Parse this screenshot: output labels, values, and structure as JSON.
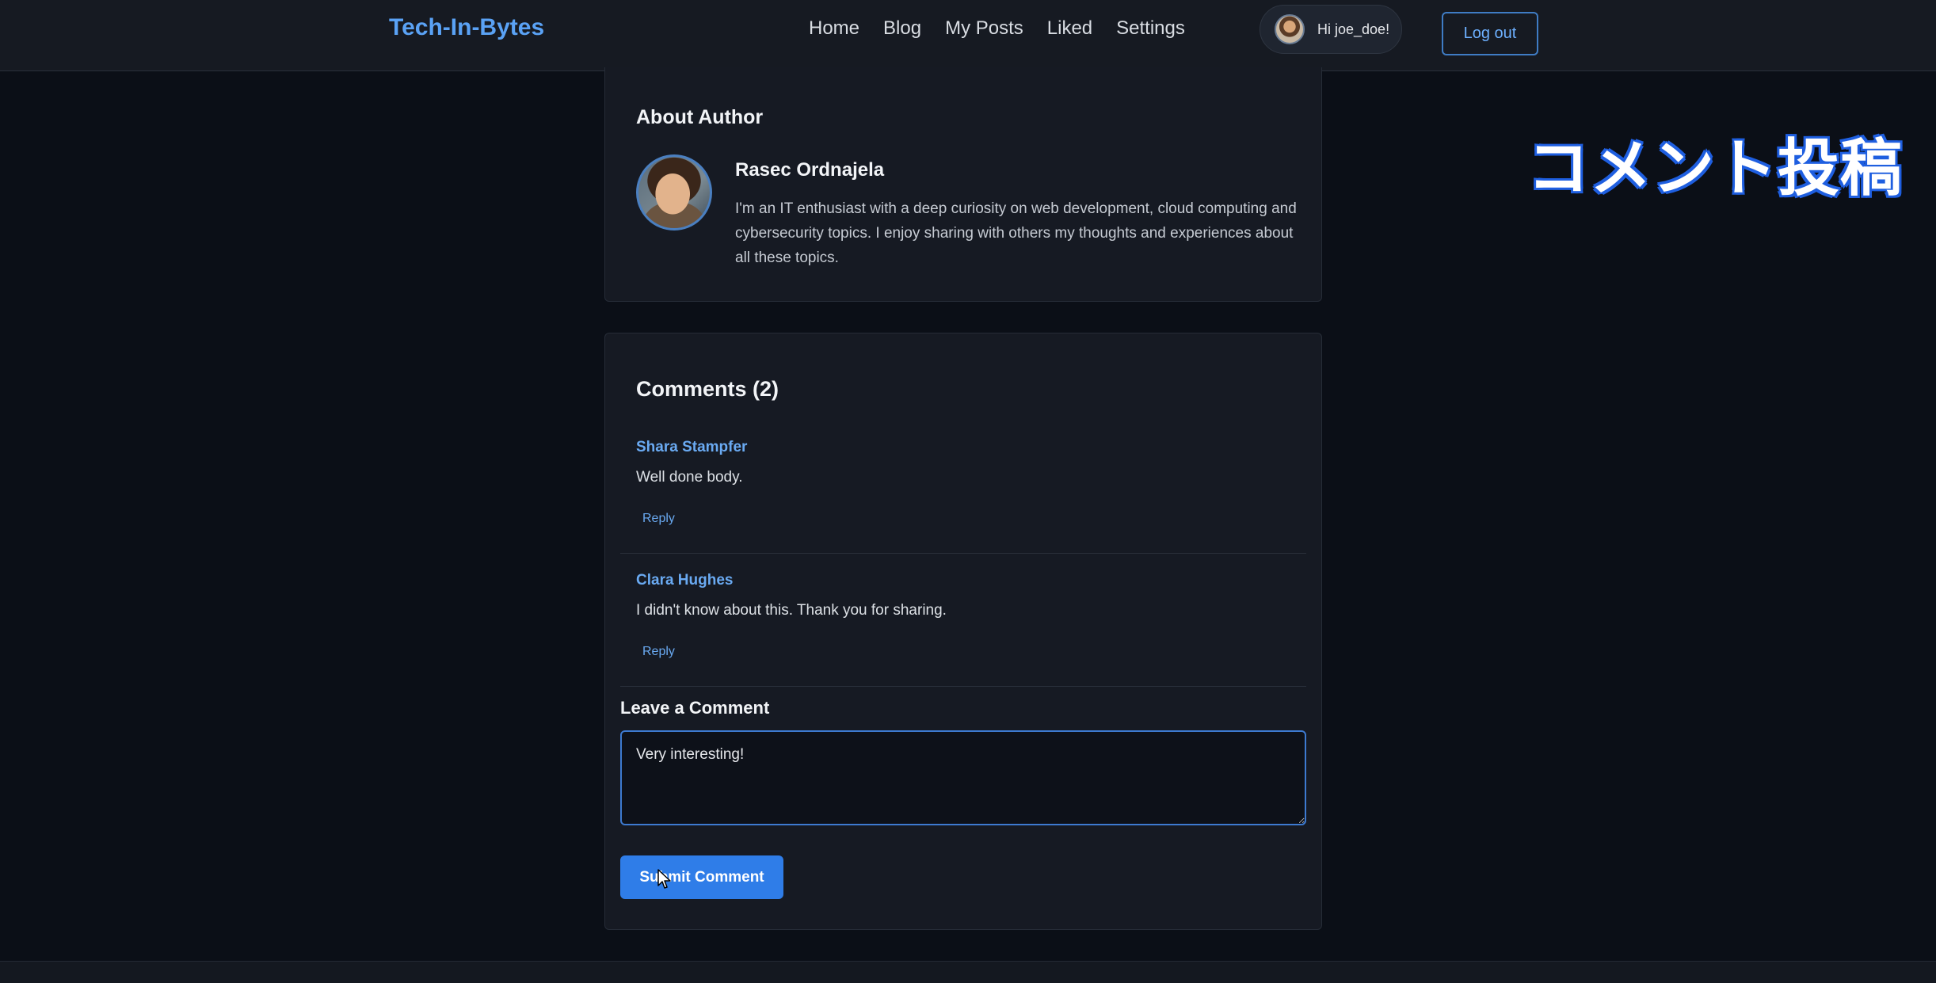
{
  "nav": {
    "brand": "Tech-In-Bytes",
    "links": [
      "Home",
      "Blog",
      "My Posts",
      "Liked",
      "Settings"
    ],
    "user_greeting": "Hi joe_doe!",
    "logout_label": "Log out"
  },
  "overlay": {
    "caption": "コメント投稿"
  },
  "about": {
    "heading": "About Author",
    "author_name": "Rasec Ordnajela",
    "bio": "I'm an IT enthusiast with a deep curiosity on web development, cloud computing and cybersecurity topics. I enjoy sharing with others my thoughts and experiences about all these topics."
  },
  "comments": {
    "heading": "Comments (2)",
    "items": [
      {
        "author": "Shara Stampfer",
        "text": "Well done body.",
        "reply_label": "Reply"
      },
      {
        "author": "Clara Hughes",
        "text": "I didn't know about this. Thank you for sharing.",
        "reply_label": "Reply"
      }
    ]
  },
  "leave_comment": {
    "heading": "Leave a Comment",
    "textarea_value": "Very interesting!",
    "submit_label": "Submit Comment"
  },
  "colors": {
    "accent": "#2f7de8",
    "link": "#6aaaf2",
    "background": "#0b0f17",
    "card": "#161a23"
  }
}
